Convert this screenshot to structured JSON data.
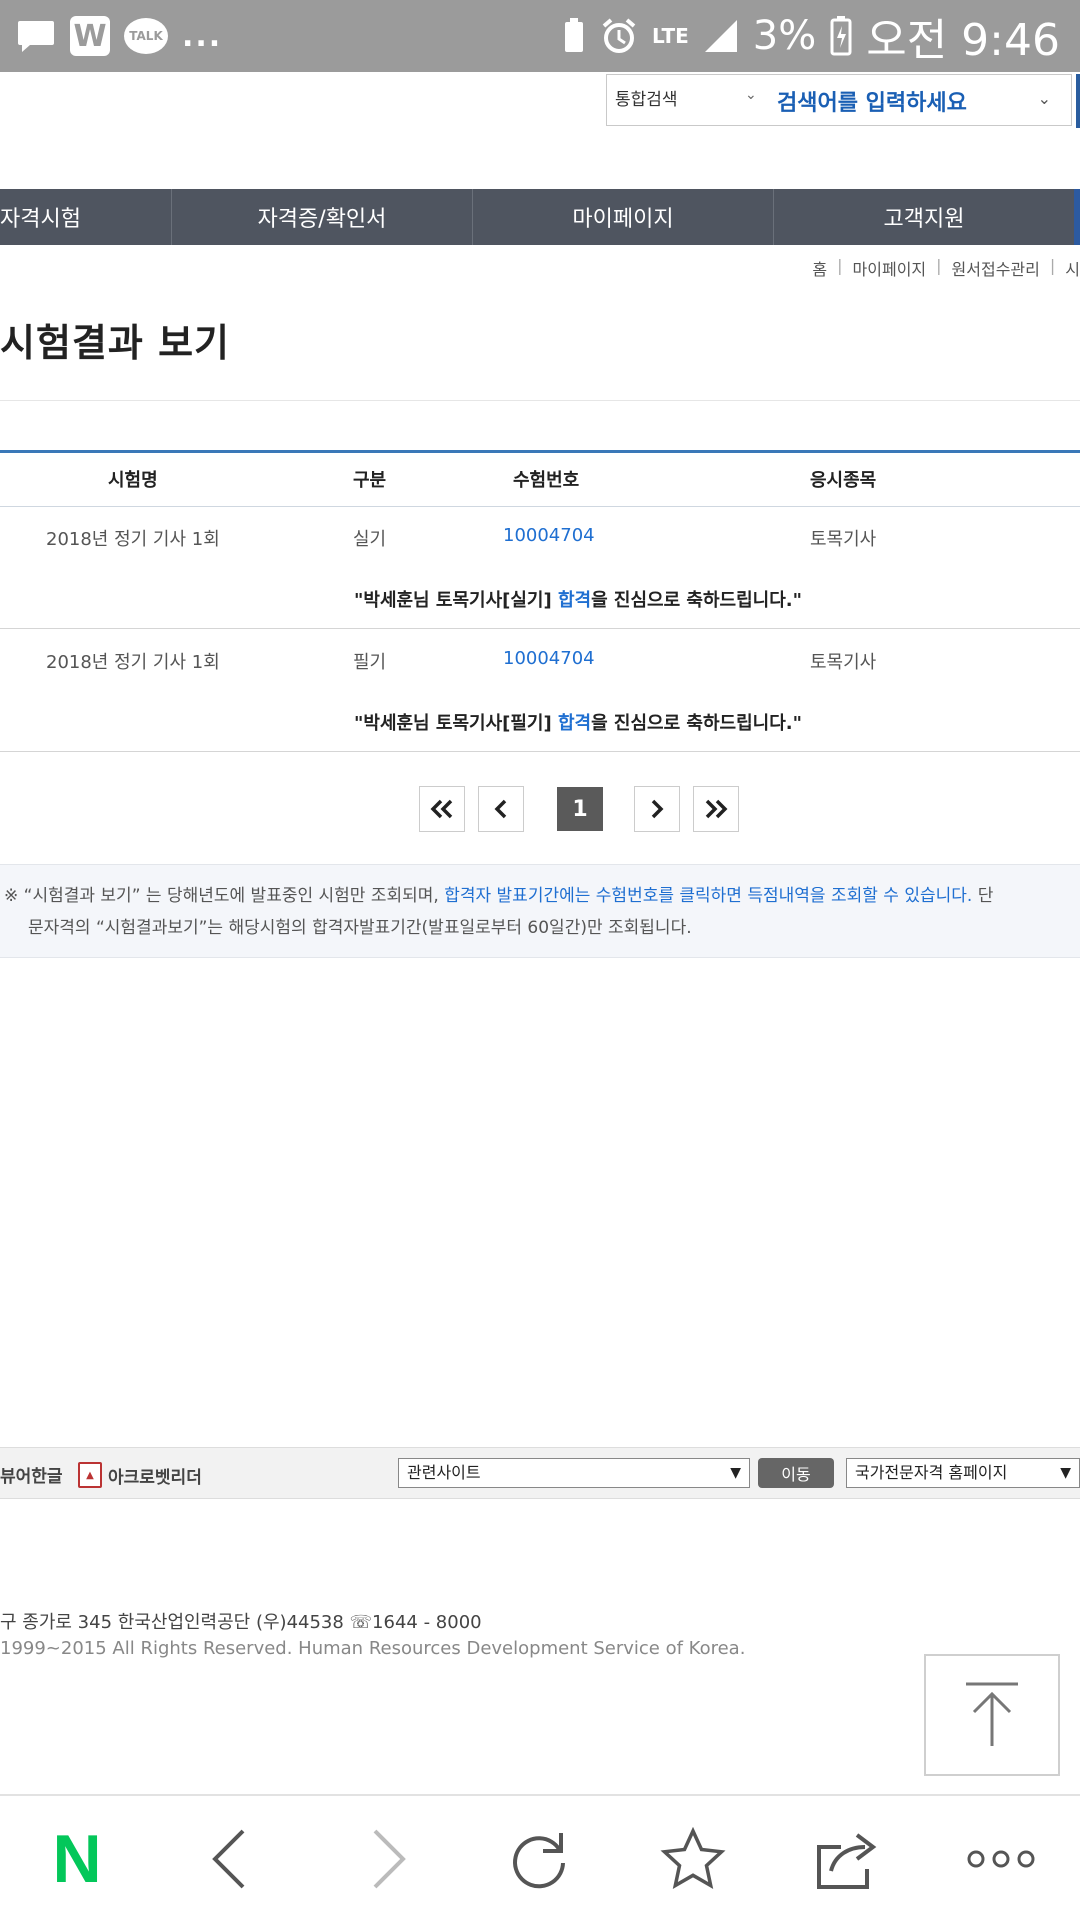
{
  "status_bar": {
    "app_w": "W",
    "app_talk": "TALK",
    "more": "...",
    "network": "LTE",
    "battery_pct": "3%",
    "time": "오전 9:46"
  },
  "search": {
    "scope": "통합검색",
    "placeholder": "검색어를 입력하세요"
  },
  "nav": {
    "items": [
      "자격시험",
      "자격증/확인서",
      "마이페이지",
      "고객지원"
    ]
  },
  "breadcrumb": [
    "홈",
    "마이페이지",
    "원서접수관리",
    "시"
  ],
  "page_title": "시험결과 보기",
  "table": {
    "headers": [
      "시험명",
      "구분",
      "수험번호",
      "응시종목"
    ],
    "rows": [
      {
        "exam": "2018년 정기 기사 1회",
        "type": "실기",
        "number": "10004704",
        "subject": "토목기사",
        "msg_pre": "\"박세훈님 토목기사[실기] ",
        "msg_hl": "합격",
        "msg_post": "을 진심으로 축하드립니다.\""
      },
      {
        "exam": "2018년 정기 기사 1회",
        "type": "필기",
        "number": "10004704",
        "subject": "토목기사",
        "msg_pre": "\"박세훈님 토목기사[필기] ",
        "msg_hl": "합격",
        "msg_post": "을 진심으로 축하드립니다.\""
      }
    ]
  },
  "pagination": {
    "current": "1"
  },
  "notice": {
    "line1_pre": "※ “시험결과 보기” 는 당해년도에 발표중인 시험만 조회되며, ",
    "line1_blue": "합격자 발표기간에는 수험번호를 클릭하면 득점내역을 조회할 수 있습니다.",
    "line1_post": " 단",
    "line2": "문자격의 “시험결과보기”는 해당시험의 합격자발표기간(발표일로부터 60일간)만 조회됩니다."
  },
  "footer_bar": {
    "hangul_viewer": "뷰어한글",
    "acrobat": "아크로벳리더",
    "related_sites": "관련사이트",
    "go_button": "이동",
    "national_site": "국가전문자격 홈페이지"
  },
  "footer": {
    "address": "구 종가로 345 한국산업인력공단 (우)44538 ☏1644 - 8000",
    "copyright": "1999~2015 All Rights Reserved. Human Resources Development Service of Korea."
  },
  "bottom_nav": {
    "naver": "N"
  },
  "colors": {
    "accent_blue": "#1f6fd1",
    "nav_bg": "#4f5560",
    "naver_green": "#03c75a"
  }
}
